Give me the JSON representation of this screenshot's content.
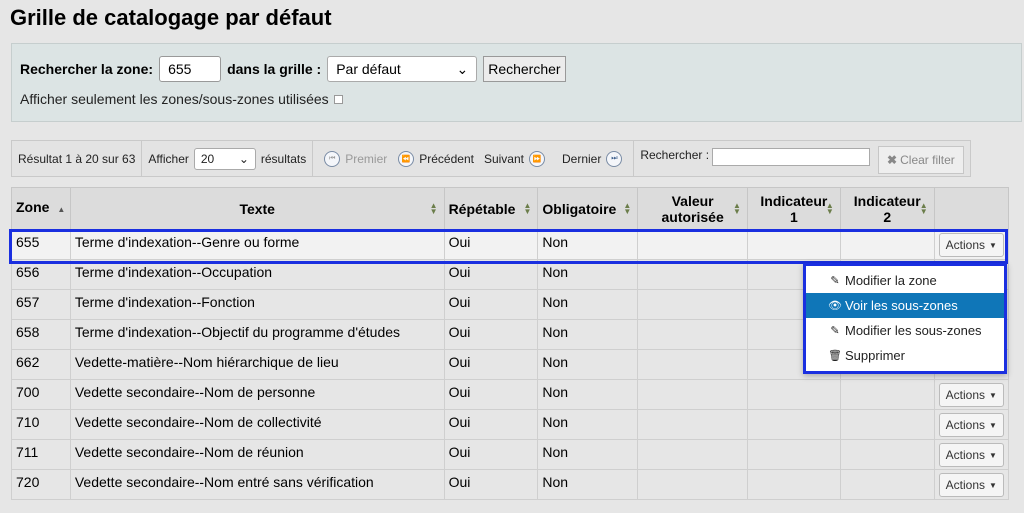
{
  "page": {
    "title": "Grille de catalogage par défaut"
  },
  "search": {
    "zone_label": "Rechercher la zone:",
    "zone_value": "655",
    "grid_label": "dans la grille :",
    "grid_selected": "Par défaut",
    "button_label": "Rechercher",
    "used_only_label": "Afficher seulement les zones/sous-zones utilisées"
  },
  "toolbar": {
    "result_info": "Résultat 1 à 20 sur 63",
    "show_label": "Afficher",
    "page_size": "20",
    "results_label": "résultats",
    "first": "Premier",
    "previous": "Précédent",
    "next": "Suivant",
    "last": "Dernier",
    "filter_label": "Rechercher :",
    "clear_filter": "Clear filter"
  },
  "table": {
    "headers": {
      "zone": "Zone",
      "text": "Texte",
      "repeatable": "Répétable",
      "mandatory": "Obligatoire",
      "value_l1": "Valeur",
      "value_l2": "autorisée",
      "ind1_l1": "Indicateur",
      "ind1_l2": "1",
      "ind2_l1": "Indicateur",
      "ind2_l2": "2"
    },
    "actions_label": "Actions",
    "rows": [
      {
        "zone": "655",
        "text": "Terme d'indexation--Genre ou forme",
        "repeatable": "Oui",
        "mandatory": "Non"
      },
      {
        "zone": "656",
        "text": "Terme d'indexation--Occupation",
        "repeatable": "Oui",
        "mandatory": "Non"
      },
      {
        "zone": "657",
        "text": "Terme d'indexation--Fonction",
        "repeatable": "Oui",
        "mandatory": "Non"
      },
      {
        "zone": "658",
        "text": "Terme d'indexation--Objectif du programme d'études",
        "repeatable": "Oui",
        "mandatory": "Non"
      },
      {
        "zone": "662",
        "text": "Vedette-matière--Nom hiérarchique de lieu",
        "repeatable": "Oui",
        "mandatory": "Non"
      },
      {
        "zone": "700",
        "text": "Vedette secondaire--Nom de personne",
        "repeatable": "Oui",
        "mandatory": "Non"
      },
      {
        "zone": "710",
        "text": "Vedette secondaire--Nom de collectivité",
        "repeatable": "Oui",
        "mandatory": "Non"
      },
      {
        "zone": "711",
        "text": "Vedette secondaire--Nom de réunion",
        "repeatable": "Oui",
        "mandatory": "Non"
      },
      {
        "zone": "720",
        "text": "Vedette secondaire--Nom entré sans vérification",
        "repeatable": "Oui",
        "mandatory": "Non"
      }
    ]
  },
  "dropdown": {
    "items": [
      {
        "label": "Modifier la zone",
        "icon": "pencil-icon"
      },
      {
        "label": "Voir les sous-zones",
        "icon": "eye-icon"
      },
      {
        "label": "Modifier les sous-zones",
        "icon": "pencil-icon"
      },
      {
        "label": "Supprimer",
        "icon": "trash-icon"
      }
    ]
  },
  "colors": {
    "highlight": "#1a2fe0",
    "menu_active": "#0f76b8"
  }
}
